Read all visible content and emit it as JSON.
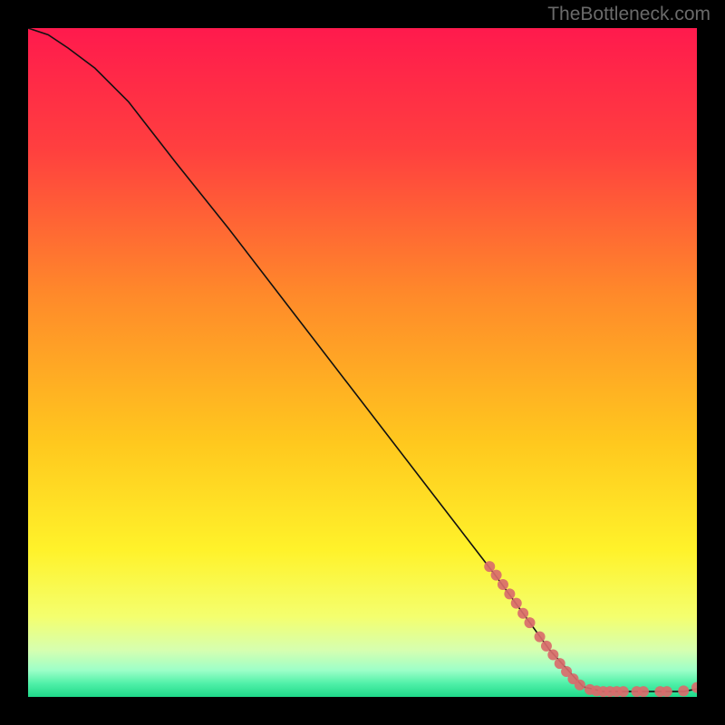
{
  "watermark": "TheBottleneck.com",
  "chart_data": {
    "type": "line",
    "title": "",
    "xlabel": "",
    "ylabel": "",
    "xlim": [
      0,
      100
    ],
    "ylim": [
      0,
      100
    ],
    "background_gradient": {
      "stops": [
        {
          "offset": 0,
          "color": "#ff1a4d"
        },
        {
          "offset": 18,
          "color": "#ff3f3f"
        },
        {
          "offset": 40,
          "color": "#ff8a2a"
        },
        {
          "offset": 62,
          "color": "#ffc81e"
        },
        {
          "offset": 78,
          "color": "#fff22a"
        },
        {
          "offset": 88,
          "color": "#f4ff6e"
        },
        {
          "offset": 93,
          "color": "#d6ffb0"
        },
        {
          "offset": 96,
          "color": "#9dffc8"
        },
        {
          "offset": 98,
          "color": "#50f0a8"
        },
        {
          "offset": 100,
          "color": "#1fd98a"
        }
      ]
    },
    "series": [
      {
        "name": "curve",
        "type": "line",
        "color": "#111111",
        "points": [
          {
            "x": 0,
            "y": 100
          },
          {
            "x": 3,
            "y": 99
          },
          {
            "x": 6,
            "y": 97
          },
          {
            "x": 10,
            "y": 94
          },
          {
            "x": 15,
            "y": 89
          },
          {
            "x": 22,
            "y": 80
          },
          {
            "x": 30,
            "y": 70
          },
          {
            "x": 40,
            "y": 57
          },
          {
            "x": 50,
            "y": 44
          },
          {
            "x": 60,
            "y": 31
          },
          {
            "x": 70,
            "y": 18
          },
          {
            "x": 78,
            "y": 7
          },
          {
            "x": 83,
            "y": 1.5
          },
          {
            "x": 86,
            "y": 0.8
          },
          {
            "x": 90,
            "y": 0.8
          },
          {
            "x": 95,
            "y": 0.8
          },
          {
            "x": 98,
            "y": 0.8
          },
          {
            "x": 100,
            "y": 1.2
          }
        ]
      },
      {
        "name": "highlighted-segment",
        "type": "scatter",
        "color": "#d96b6b",
        "radius": 6,
        "points": [
          {
            "x": 69,
            "y": 19.5
          },
          {
            "x": 70,
            "y": 18.2
          },
          {
            "x": 71,
            "y": 16.8
          },
          {
            "x": 72,
            "y": 15.4
          },
          {
            "x": 73,
            "y": 14.0
          },
          {
            "x": 74,
            "y": 12.5
          },
          {
            "x": 75,
            "y": 11.1
          },
          {
            "x": 76.5,
            "y": 9.0
          },
          {
            "x": 77.5,
            "y": 7.6
          },
          {
            "x": 78.5,
            "y": 6.3
          },
          {
            "x": 79.5,
            "y": 5.0
          },
          {
            "x": 80.5,
            "y": 3.8
          },
          {
            "x": 81.5,
            "y": 2.7
          },
          {
            "x": 82.5,
            "y": 1.8
          },
          {
            "x": 84,
            "y": 1.1
          },
          {
            "x": 85,
            "y": 0.9
          },
          {
            "x": 86,
            "y": 0.8
          },
          {
            "x": 87,
            "y": 0.8
          },
          {
            "x": 88,
            "y": 0.8
          },
          {
            "x": 89,
            "y": 0.8
          },
          {
            "x": 91,
            "y": 0.8
          },
          {
            "x": 92,
            "y": 0.8
          },
          {
            "x": 94.5,
            "y": 0.8
          },
          {
            "x": 95.5,
            "y": 0.8
          },
          {
            "x": 98,
            "y": 0.9
          },
          {
            "x": 100,
            "y": 1.4
          }
        ]
      }
    ]
  }
}
